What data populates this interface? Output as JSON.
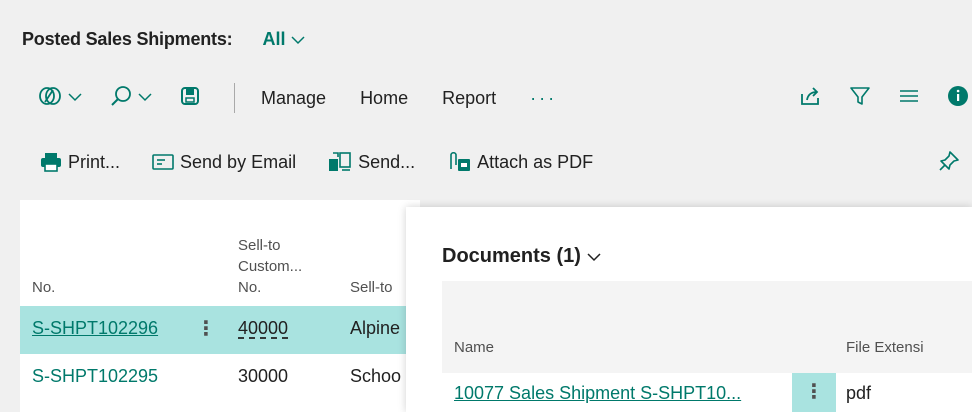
{
  "header": {
    "title": "Posted Sales Shipments:",
    "view_filter": "All"
  },
  "toolbar": {
    "menus": [
      "Manage",
      "Home",
      "Report"
    ],
    "more": "···",
    "icons": [
      "analysis-mode-icon",
      "search-icon",
      "bookmark-icon",
      "share-icon",
      "filter-icon",
      "list-view-icon",
      "info-icon"
    ]
  },
  "actions": {
    "print": "Print...",
    "send_email": "Send by Email",
    "send": "Send...",
    "attach_pdf": "Attach as PDF"
  },
  "grid": {
    "col_no": "No.",
    "col_cust_no_1": "Sell-to",
    "col_cust_no_2": "Custom...",
    "col_cust_no_3": "No.",
    "col_sell_to": "Sell-to",
    "rows": [
      {
        "no": "S-SHPT102296",
        "cust_no": "40000",
        "name": "Alpine",
        "selected": true
      },
      {
        "no": "S-SHPT102295",
        "cust_no": "30000",
        "name": "Schoo",
        "selected": false
      }
    ],
    "row_menu": "⋮"
  },
  "factbox": {
    "title": "Documents (1)",
    "col_name": "Name",
    "col_ext": "File Extensi",
    "rows": [
      {
        "name": "10077 Sales Shipment S-SHPT10...",
        "ext": "pdf"
      }
    ],
    "row_menu": "⋮"
  },
  "colors": {
    "accent": "#00796b",
    "selection": "#a9e3e0",
    "background": "#f0f0f0"
  }
}
